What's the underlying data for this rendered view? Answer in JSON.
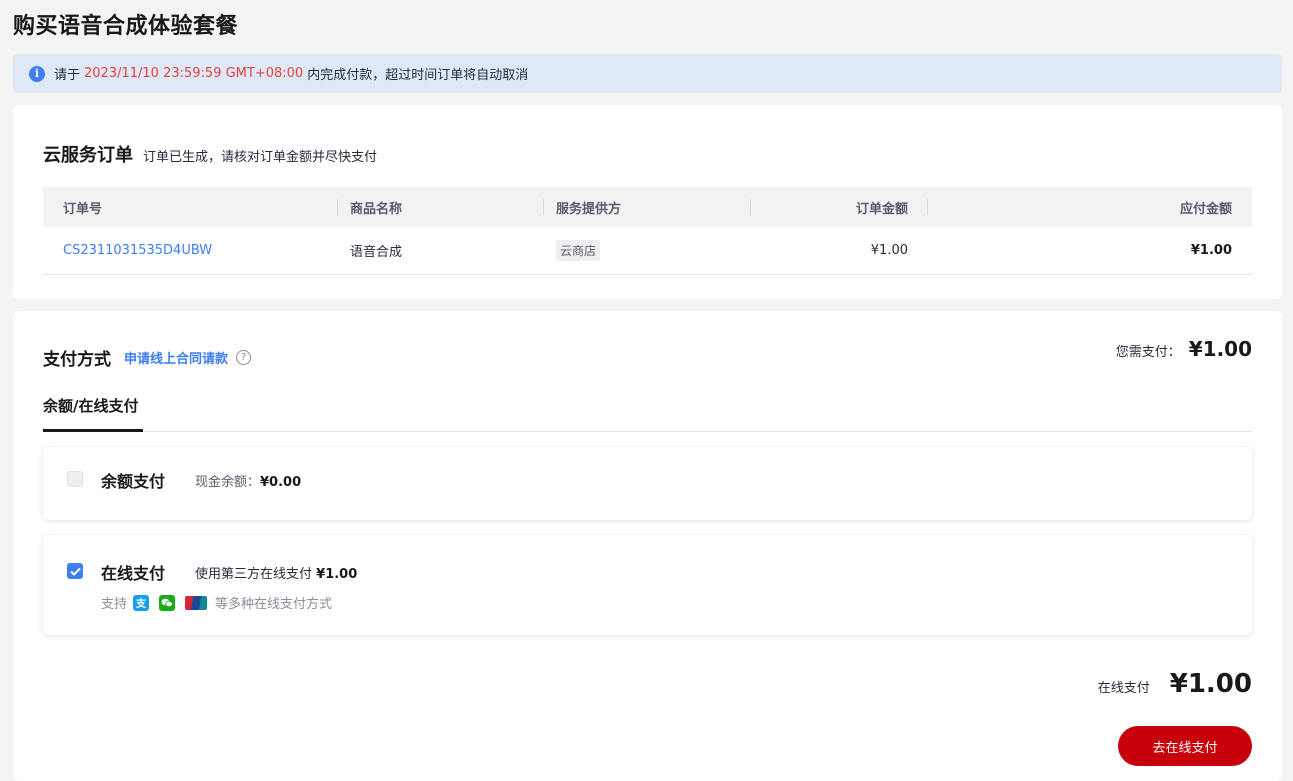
{
  "page": {
    "title": "购买语音合成体验套餐"
  },
  "notice": {
    "prefix": "请于",
    "deadline": "2023/11/10 23:59:59 GMT+08:00",
    "suffix": "内完成付款，超过时间订单将自动取消"
  },
  "order": {
    "title": "云服务订单",
    "subtitle": "订单已生成，请核对订单金额并尽快支付",
    "columns": [
      "订单号",
      "商品名称",
      "服务提供方",
      "订单金额",
      "应付金额"
    ],
    "row": {
      "order_no": "CS2311031535D4UBW",
      "product": "语音合成",
      "vendor": "云商店",
      "amount": "¥1.00",
      "payable": "¥1.00"
    }
  },
  "payment": {
    "title": "支付方式",
    "contract_link": "申请线上合同请款",
    "need_pay_label": "您需支付：",
    "need_pay_amount": "¥1.00",
    "tab": "余额/在线支付",
    "balance": {
      "title": "余额支付",
      "cash_label": "现金余额：",
      "cash_value": "¥0.00",
      "checked": false
    },
    "online": {
      "title": "在线支付",
      "desc": "使用第三方在线支付",
      "desc_amount": "¥1.00",
      "support_label": "支持",
      "support_suffix": "等多种在线支付方式",
      "checked": true,
      "icons": [
        "alipay-icon",
        "wechat-pay-icon",
        "unionpay-icon"
      ]
    },
    "total_label": "在线支付",
    "total_amount": "¥1.00",
    "pay_button": "去在线支付"
  },
  "colors": {
    "accent": "#3d7ef0",
    "danger": "#e3423b",
    "primary_button": "#c7000b"
  }
}
